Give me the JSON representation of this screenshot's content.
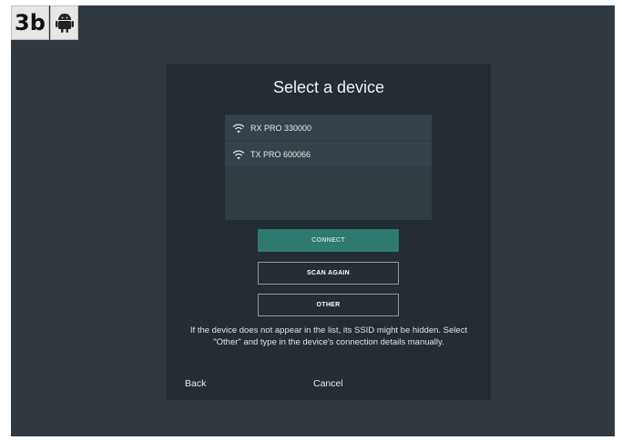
{
  "badges": {
    "step": "3b",
    "platform_icon": "android-icon"
  },
  "dialog": {
    "title": "Select a device",
    "devices": [
      {
        "icon": "wifi-icon",
        "label": "RX PRO 330000"
      },
      {
        "icon": "wifi-icon",
        "label": "TX PRO 600066"
      }
    ],
    "buttons": {
      "connect": "CONNECT",
      "scan_again": "SCAN AGAIN",
      "other": "OTHER"
    },
    "help_text": "If the device does not appear in the list, its SSID might be hidden. Select \"Other\" and type in the device's connection details manually.",
    "footer": {
      "back": "Back",
      "cancel": "Cancel"
    }
  },
  "colors": {
    "background": "#2f393f",
    "dialog": "#232d33",
    "accent": "#2f7a70"
  }
}
